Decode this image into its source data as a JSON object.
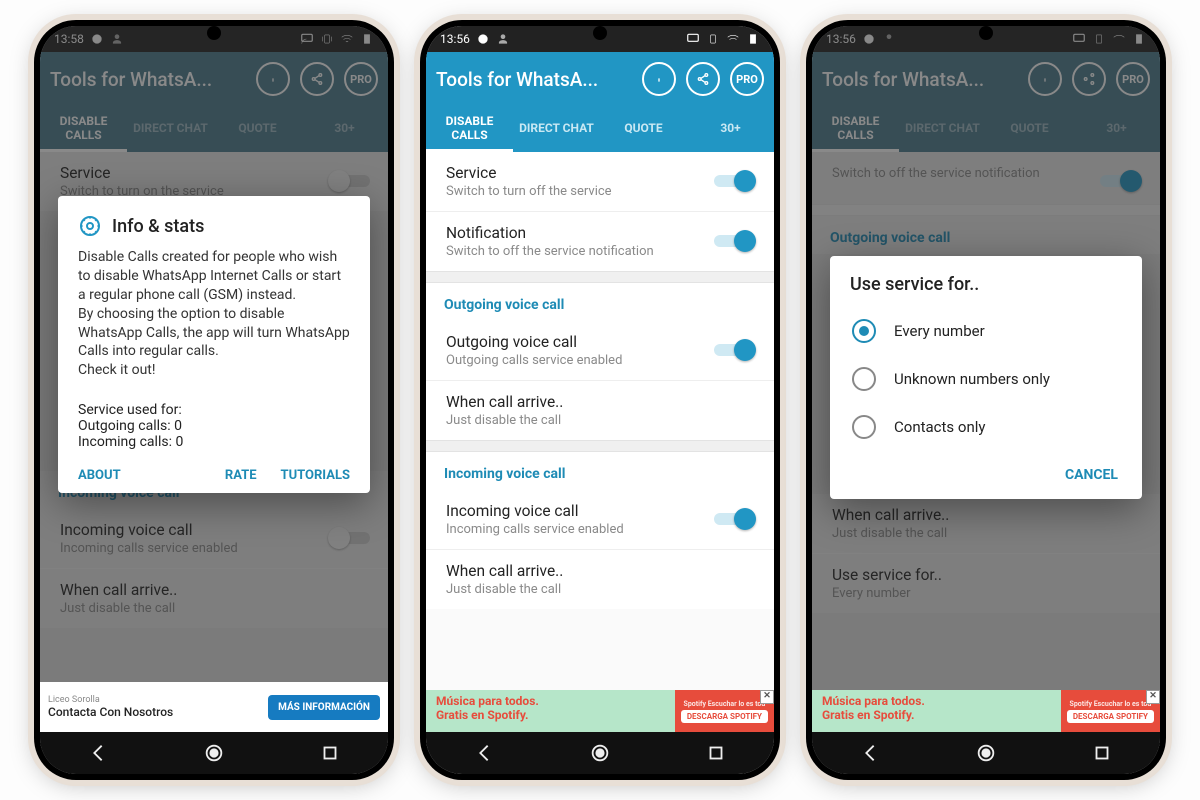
{
  "status": {
    "time1": "13:58",
    "time2": "13:56",
    "time3": "13:56"
  },
  "app": {
    "title": "Tools for WhatsA...",
    "pro": "PRO",
    "tabs": {
      "disable": "DISABLE CALLS",
      "direct": "DIRECT CHAT",
      "quote": "QUOTE",
      "more": "30+"
    }
  },
  "list": {
    "service": {
      "title": "Service",
      "on_sub": "Switch to turn off the service",
      "off_sub": "Switch to turn on the service"
    },
    "notif": {
      "title": "Notification",
      "sub": "Switch to off the service notification"
    },
    "out_sect": "Outgoing voice call",
    "out_item": {
      "title": "Outgoing voice call",
      "sub": "Outgoing calls service enabled"
    },
    "out_arrive": {
      "title": "When call arrive..",
      "sub": "Just disable the call"
    },
    "in_sect": "Incoming voice call",
    "in_item": {
      "title": "Incoming voice call",
      "sub": "Incoming calls service enabled"
    },
    "in_arrive": {
      "title": "When call arrive..",
      "sub": "Just disable the call"
    },
    "use_for": {
      "title": "Use service for..",
      "sub": "Every number"
    }
  },
  "dialog_info": {
    "title": "Info & stats",
    "body": "Disable Calls created for people who wish to disable WhatsApp Internet Calls or start a regular phone call (GSM) instead.\nBy choosing the option to disable WhatsApp Calls, the app will turn WhatsApp Calls into regular calls.\nCheck it out!",
    "stats_label": "Service used for:",
    "stats_out": "Outgoing calls: 0",
    "stats_in": "Incoming calls: 0",
    "about": "ABOUT",
    "rate": "RATE",
    "tutorials": "TUTORIALS"
  },
  "dialog_radio": {
    "title": "Use service for..",
    "opt1": "Every number",
    "opt2": "Unknown numbers only",
    "opt3": "Contacts only",
    "cancel": "CANCEL"
  },
  "ad_spotify": {
    "l1": "Música para todos.",
    "l2": "Gratis en Spotify.",
    "sub": "Spotify  Escuchar lo es tod",
    "btn": "DESCARGA SPOTIFY"
  },
  "ad_white": {
    "l1": "Liceo Sorolla",
    "l2": "Contacta Con Nosotros",
    "btn": "MÁS INFORMACIÓN"
  }
}
